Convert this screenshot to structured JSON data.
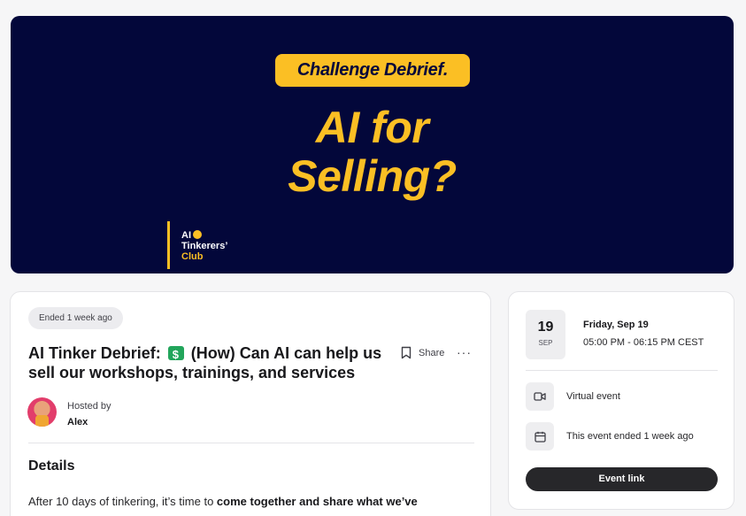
{
  "banner": {
    "pill": "Challenge Debrief.",
    "headline_line1": "AI for",
    "headline_line2": "Selling?",
    "brand_line1": "AI",
    "brand_line2": "Tinkerers’",
    "brand_line3": "Club"
  },
  "event": {
    "status": "Ended 1 week ago",
    "title_part1": "AI Tinker Debrief:",
    "title_emoji": "money-with-wings",
    "title_part2": "(How) Can AI can help us sell our workshops, trainings, and services",
    "share_label": "Share",
    "more_label": "···",
    "hosted_by_label": "Hosted by",
    "host_name": "Alex",
    "details_heading": "Details",
    "details_text_start": "After 10 days of tinkering, it’s time to ",
    "details_text_bold": "come together and share what we’ve learned!",
    "details_text_end": ""
  },
  "sidebar": {
    "date_day": "19",
    "date_month": "SEP",
    "date_full": "Friday, Sep 19",
    "time_range": "05:00 PM - 06:15 PM CEST",
    "location_text": "Virtual event",
    "ended_text": "This event ended 1 week ago",
    "event_link_label": "Event link"
  },
  "icons": {
    "bookmark": "bookmark-icon",
    "video": "video-icon",
    "calendar": "calendar-icon"
  },
  "colors": {
    "banner_bg": "#03073a",
    "accent_yellow": "#fbbf24",
    "button_dark": "#27272a"
  }
}
